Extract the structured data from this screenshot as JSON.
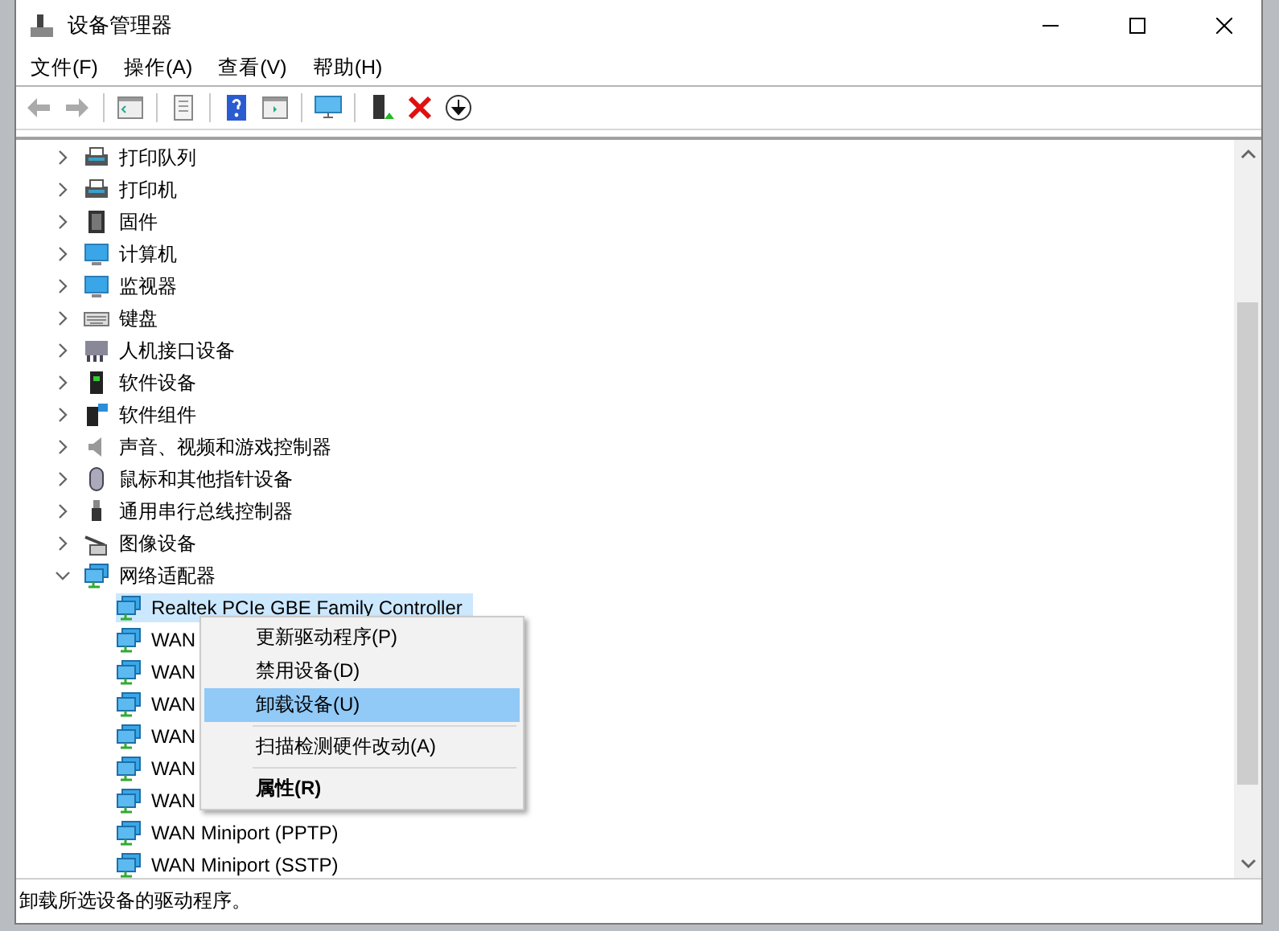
{
  "window": {
    "title": "设备管理器"
  },
  "menu_bar": [
    {
      "label": "文件(F)"
    },
    {
      "label": "操作(A)"
    },
    {
      "label": "查看(V)"
    },
    {
      "label": "帮助(H)"
    }
  ],
  "toolbar": [
    {
      "kind": "back",
      "disabled": true
    },
    {
      "kind": "forward",
      "disabled": true
    },
    {
      "kind": "sep"
    },
    {
      "kind": "tree",
      "disabled": false
    },
    {
      "kind": "sep"
    },
    {
      "kind": "props",
      "disabled": false
    },
    {
      "kind": "sep"
    },
    {
      "kind": "help",
      "disabled": false
    },
    {
      "kind": "view",
      "disabled": false
    },
    {
      "kind": "sep"
    },
    {
      "kind": "scan",
      "disabled": false
    },
    {
      "kind": "sep"
    },
    {
      "kind": "update",
      "disabled": false
    },
    {
      "kind": "remove",
      "disabled": false
    },
    {
      "kind": "down",
      "disabled": false
    }
  ],
  "tree": [
    {
      "label": "打印队列",
      "kind": "printer",
      "expanded": false
    },
    {
      "label": "打印机",
      "kind": "printer",
      "expanded": false
    },
    {
      "label": "固件",
      "kind": "chip",
      "expanded": false
    },
    {
      "label": "计算机",
      "kind": "monitor",
      "expanded": false
    },
    {
      "label": "监视器",
      "kind": "monitor",
      "expanded": false
    },
    {
      "label": "键盘",
      "kind": "keyboard",
      "expanded": false
    },
    {
      "label": "人机接口设备",
      "kind": "hid",
      "expanded": false
    },
    {
      "label": "软件设备",
      "kind": "device",
      "expanded": false
    },
    {
      "label": "软件组件",
      "kind": "component",
      "expanded": false
    },
    {
      "label": "声音、视频和游戏控制器",
      "kind": "speaker",
      "expanded": false
    },
    {
      "label": "鼠标和其他指针设备",
      "kind": "mouse",
      "expanded": false
    },
    {
      "label": "通用串行总线控制器",
      "kind": "usb",
      "expanded": false
    },
    {
      "label": "图像设备",
      "kind": "camera",
      "expanded": false
    },
    {
      "label": "网络适配器",
      "kind": "network",
      "expanded": true,
      "children": [
        {
          "label": "Realtek PCIe GBE Family Controller",
          "kind": "network",
          "selected": true
        },
        {
          "label": "WAN",
          "kind": "network",
          "selected": false
        },
        {
          "label": "WAN",
          "kind": "network",
          "selected": false
        },
        {
          "label": "WAN",
          "kind": "network",
          "selected": false
        },
        {
          "label": "WAN",
          "kind": "network",
          "selected": false
        },
        {
          "label": "WAN",
          "kind": "network",
          "selected": false
        },
        {
          "label": "WAN",
          "kind": "network",
          "selected": false
        },
        {
          "label": "WAN Miniport (PPTP)",
          "kind": "network",
          "selected": false
        },
        {
          "label": "WAN Miniport (SSTP)",
          "kind": "network",
          "selected": false
        }
      ]
    }
  ],
  "context_menu": [
    {
      "label": "更新驱动程序(P)",
      "kind": "item",
      "selected": false
    },
    {
      "label": "禁用设备(D)",
      "kind": "item",
      "selected": false
    },
    {
      "label": "卸载设备(U)",
      "kind": "item",
      "selected": true
    },
    {
      "kind": "separator"
    },
    {
      "label": "扫描检测硬件改动(A)",
      "kind": "item",
      "selected": false
    },
    {
      "kind": "separator"
    },
    {
      "label": "属性(R)",
      "kind": "default",
      "selected": false
    }
  ],
  "status_bar": {
    "text": "卸载所选设备的驱动程序。"
  }
}
